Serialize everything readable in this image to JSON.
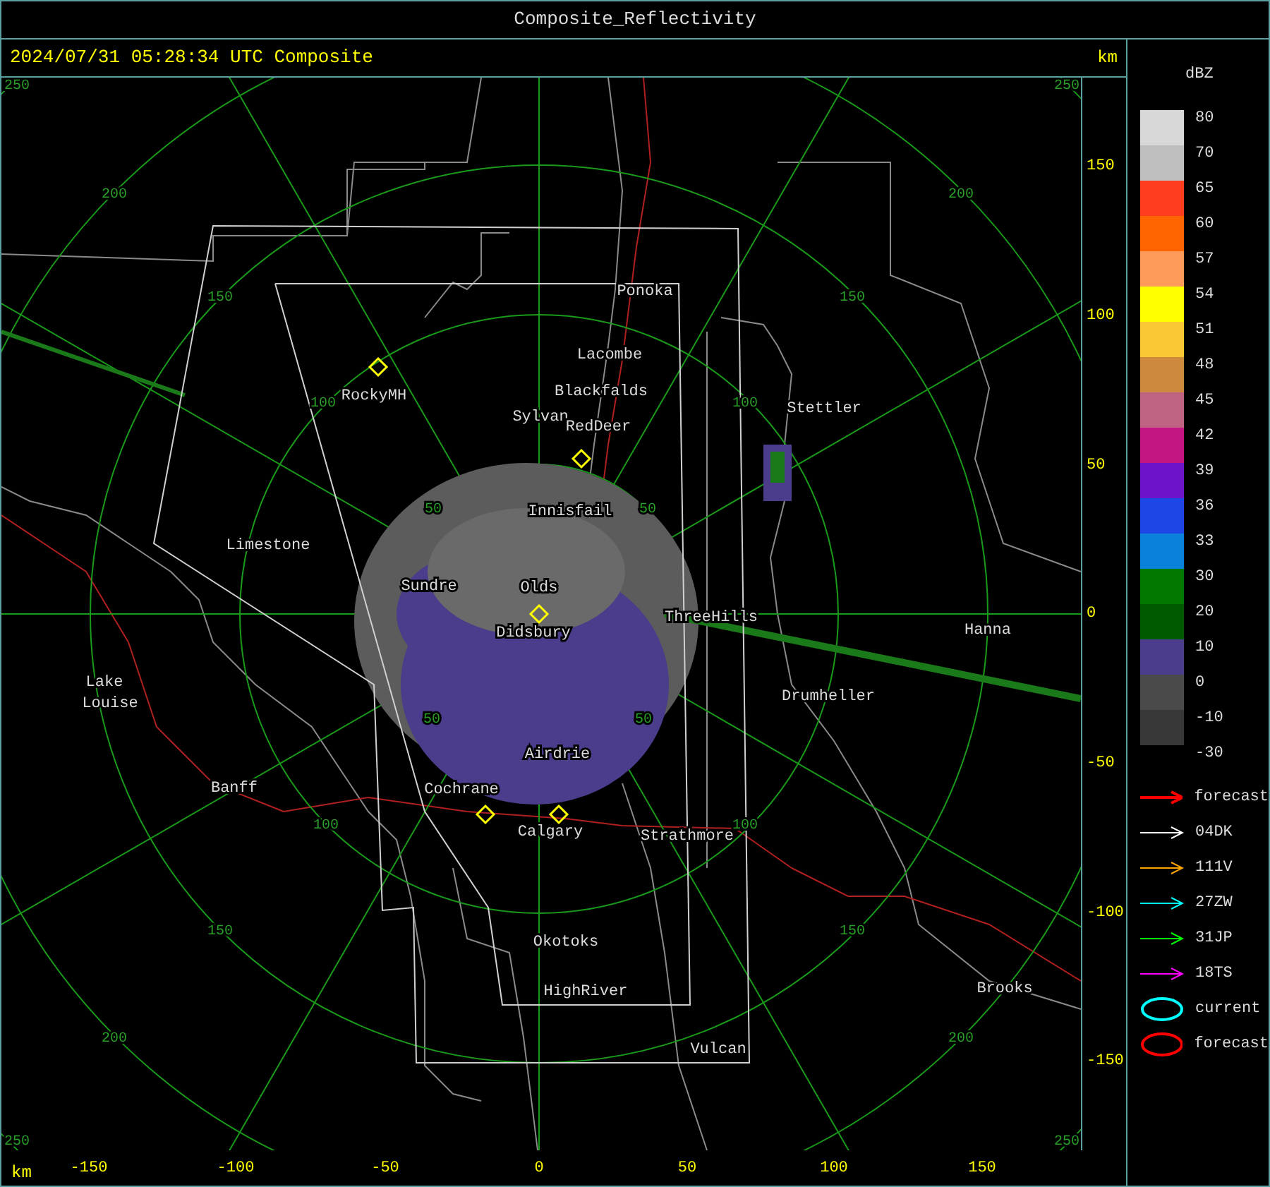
{
  "window": {
    "title": "Composite_Reflectivity"
  },
  "header": {
    "timestamp": "2024/07/31 05:28:34 UTC Composite",
    "unit": "km"
  },
  "map": {
    "ring_labels": [
      "250",
      "200",
      "150",
      "100",
      "50",
      "250",
      "200",
      "150",
      "100",
      "50",
      "50",
      "100",
      "150",
      "200",
      "250",
      "50",
      "100",
      "150",
      "200",
      "250"
    ],
    "places": [
      "Ponoka",
      "Lacombe",
      "Blackfalds",
      "Sylvan",
      "RedDeer",
      "RockyMH",
      "Stettler",
      "Innisfail",
      "Limestone",
      "Sundre",
      "Olds",
      "ThreeHills",
      "Didsbury",
      "Hanna",
      "Drumheller",
      "Lake",
      "Louise",
      "Airdrie",
      "Banff",
      "Cochrane",
      "Calgary",
      "Strathmore",
      "Okotoks",
      "HighRiver",
      "Brooks",
      "Vulcan"
    ]
  },
  "y_axis": {
    "labels": [
      "150",
      "100",
      "50",
      "0",
      "-50",
      "-100",
      "-150"
    ]
  },
  "x_axis": {
    "unit": "km",
    "labels": [
      "-150",
      "-100",
      "-50",
      "0",
      "50",
      "100",
      "150"
    ]
  },
  "legend": {
    "title": "dBZ",
    "scale_labels": [
      "80",
      "70",
      "65",
      "60",
      "57",
      "54",
      "51",
      "48",
      "45",
      "42",
      "39",
      "36",
      "33",
      "30",
      "20",
      "10",
      "0",
      "-10",
      "-30"
    ],
    "bands": [
      {
        "color": "#d8d8d8"
      },
      {
        "color": "#bebebe"
      },
      {
        "color": "#ff3c1e"
      },
      {
        "color": "#ff6400"
      },
      {
        "color": "#ff9b5a"
      },
      {
        "color": "#ffff00"
      },
      {
        "color": "#fac832"
      },
      {
        "color": "#cd8a3c"
      },
      {
        "color": "#be6482"
      },
      {
        "color": "#c31482"
      },
      {
        "color": "#6e14c8"
      },
      {
        "color": "#1e46e6"
      },
      {
        "color": "#0a82dc"
      },
      {
        "color": "#007800"
      },
      {
        "color": "#005a00"
      },
      {
        "color": "#4b3c8c"
      },
      {
        "color": "#4a4a4a"
      },
      {
        "color": "#383838"
      }
    ],
    "tracks": [
      {
        "kind": "arrow",
        "label": "forecast",
        "color": "#ff0000"
      },
      {
        "kind": "arrow",
        "label": "04DK",
        "color": "#ffffff"
      },
      {
        "kind": "arrow",
        "label": "111V",
        "color": "#ffa500"
      },
      {
        "kind": "arrow",
        "label": "27ZW",
        "color": "#00ffff"
      },
      {
        "kind": "arrow",
        "label": "31JP",
        "color": "#00ff00"
      },
      {
        "kind": "arrow",
        "label": "18TS",
        "color": "#ff00ff"
      },
      {
        "kind": "ellipse",
        "label": "current",
        "color": "#00ffff"
      },
      {
        "kind": "ellipse",
        "label": "forecast",
        "color": "#ff0000"
      }
    ]
  }
}
